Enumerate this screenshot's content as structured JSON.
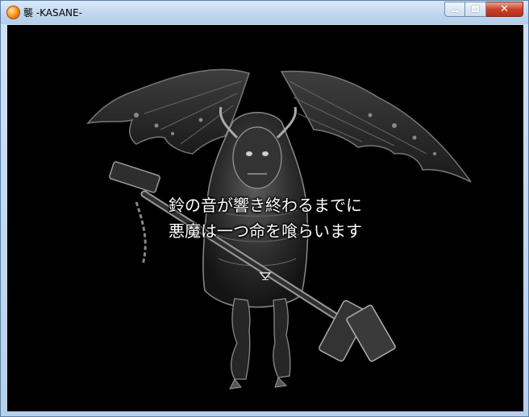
{
  "window": {
    "title": "襲 -KASANE-",
    "app_icon": "orange-orb-icon",
    "buttons": {
      "minimize": "minimize-icon",
      "maximize": "maximize-icon",
      "close": "✕"
    }
  },
  "game": {
    "background_color": "#000000",
    "message_lines": [
      "鈴の音が響き終わるまでに",
      "悪魔は一つ命を喰らいます"
    ],
    "continue_indicator": "down-triangle-icon",
    "artwork": "winged-demon-with-chained-hammer"
  }
}
